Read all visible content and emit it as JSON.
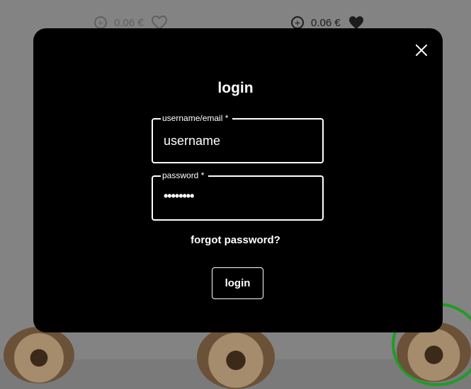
{
  "background": {
    "products": [
      {
        "price": "0.06 €",
        "heart_state": "outline",
        "add_icon": "plus-circle-icon"
      },
      {
        "price": "0.06 €",
        "heart_state": "filled",
        "add_icon": "plus-circle-icon"
      }
    ]
  },
  "modal": {
    "title": "login",
    "username": {
      "label": "username/email *",
      "value": "username"
    },
    "password": {
      "label": "password *",
      "value": "••••••••"
    },
    "forgot_password": "forgot password?",
    "submit_label": "login",
    "close_icon": "close-icon"
  },
  "colors": {
    "overlay": "#838383",
    "modal_bg": "#000000",
    "text": "#ffffff",
    "selected_ring": "#1f9c25"
  }
}
